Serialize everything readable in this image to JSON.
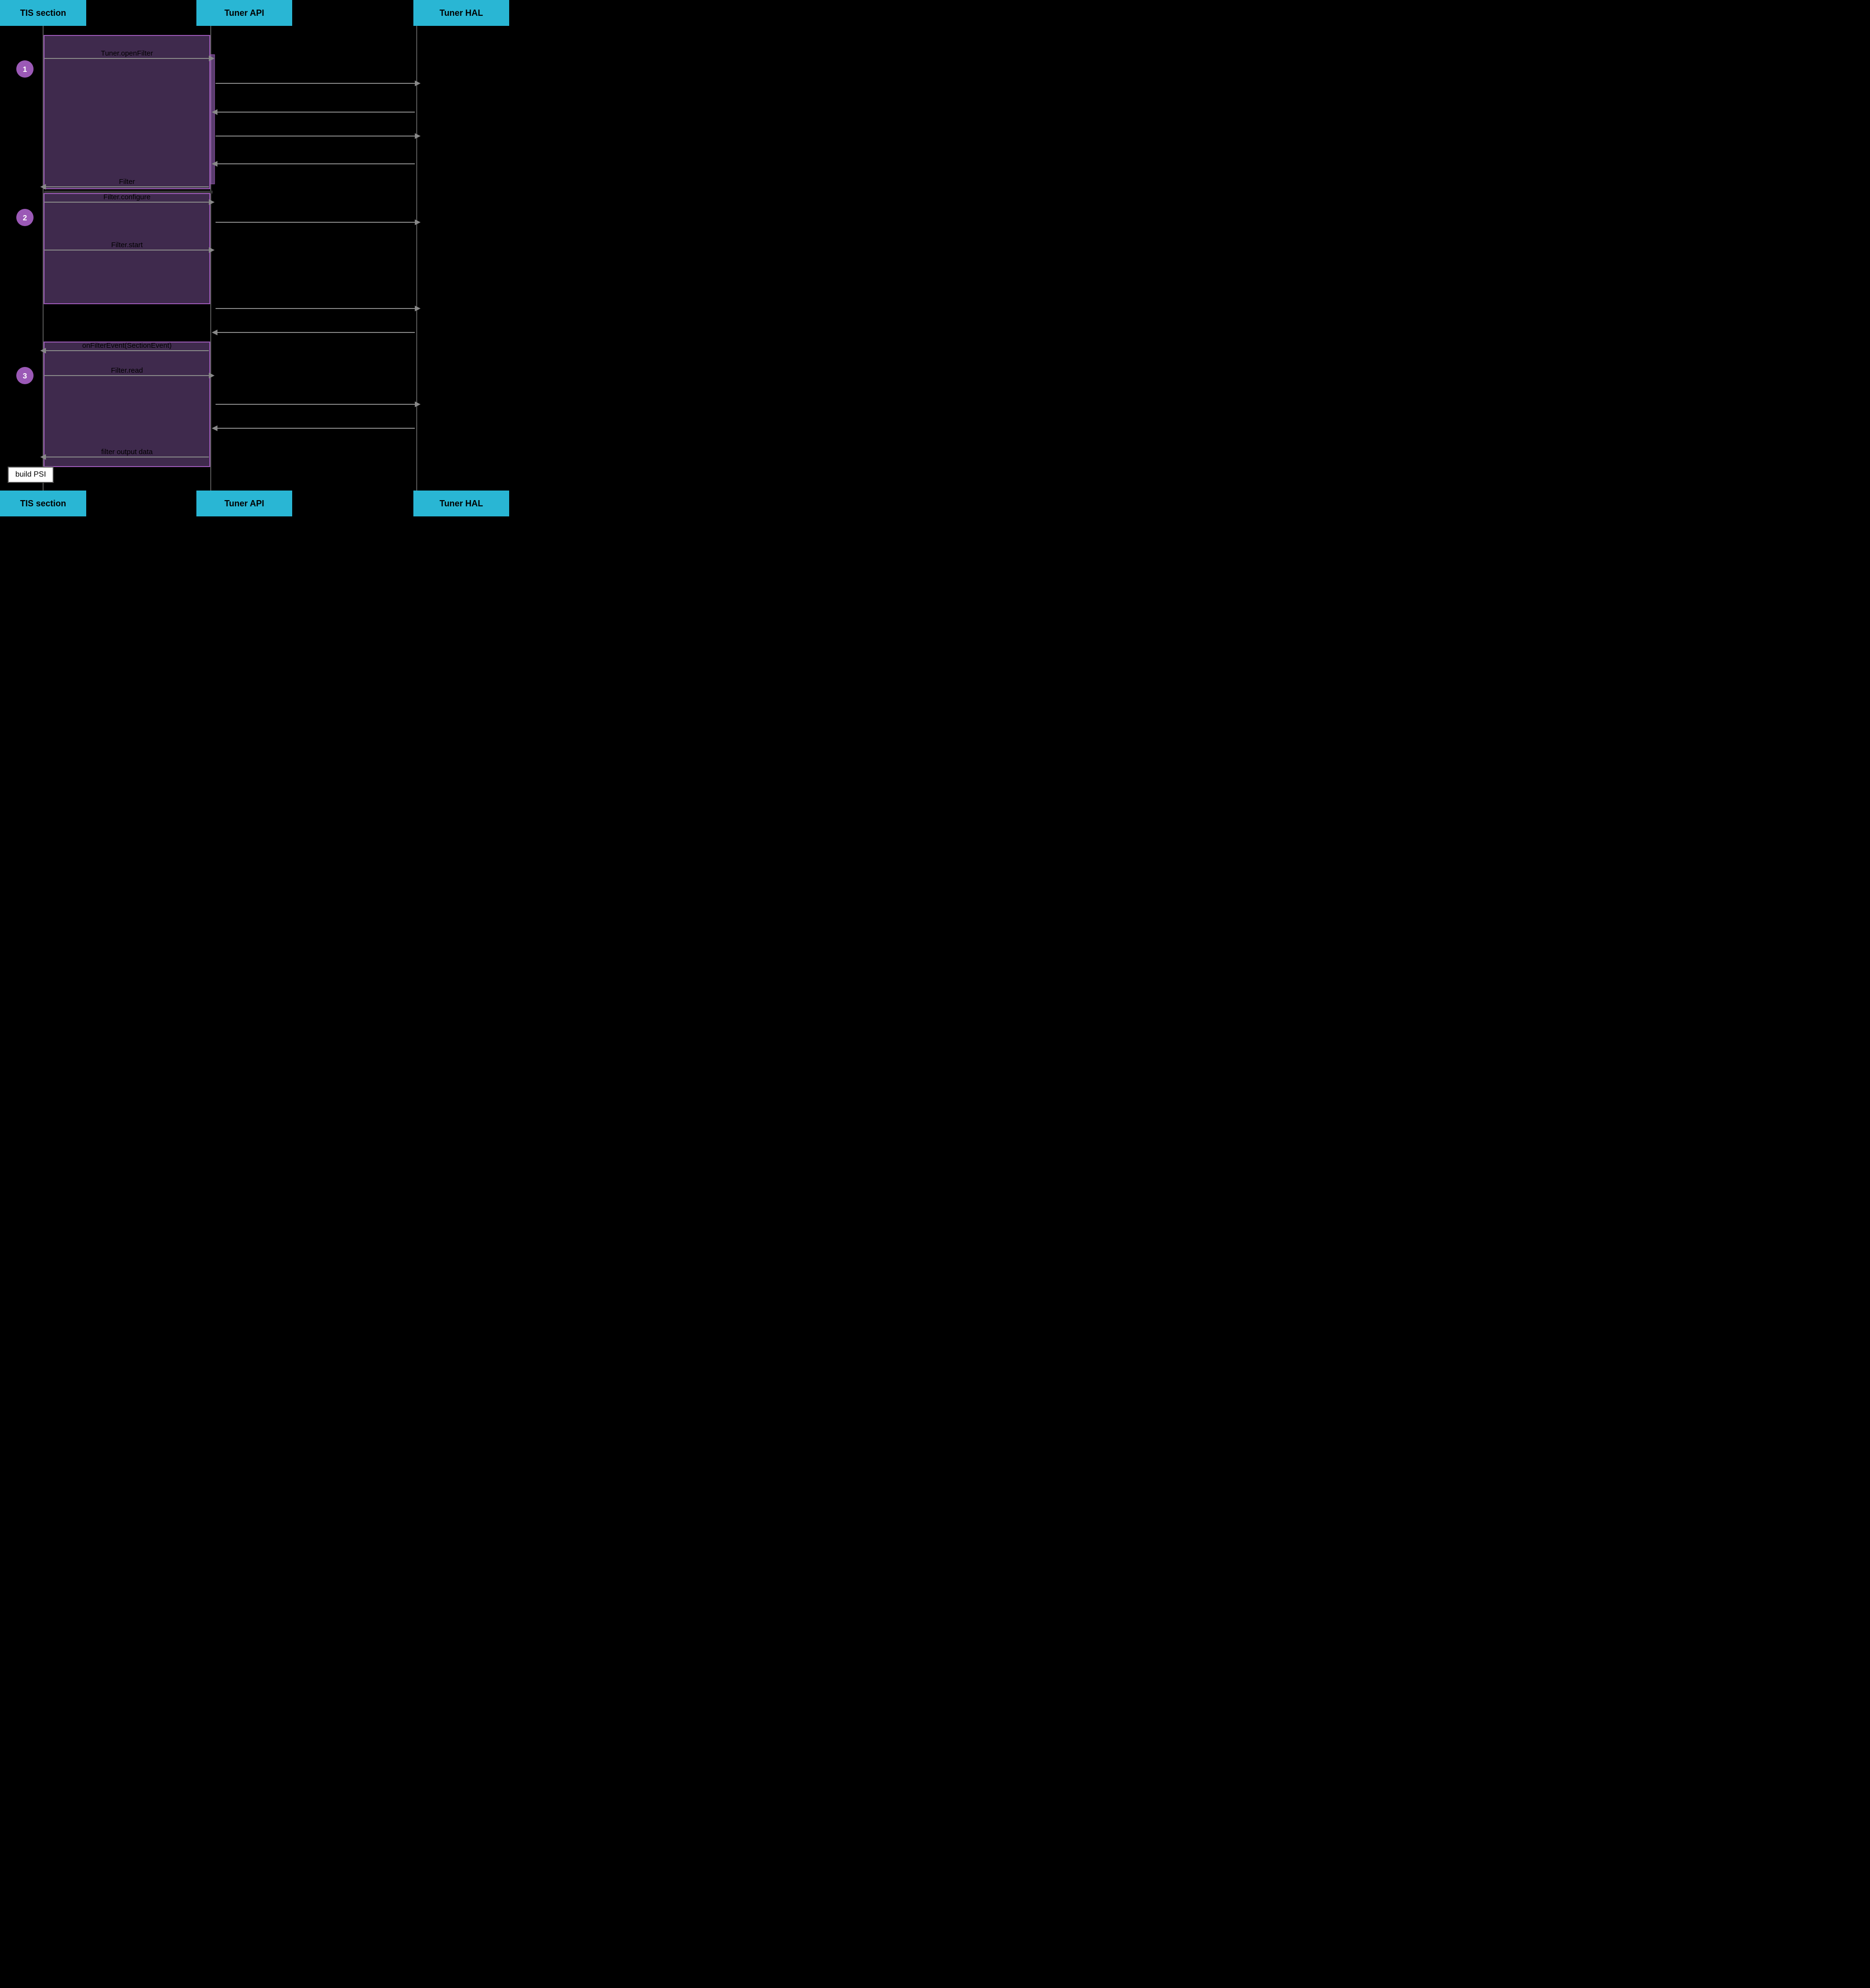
{
  "header": {
    "tis_label": "TIS section",
    "tuner_api_label": "Tuner API",
    "tuner_hal_label": "Tuner HAL"
  },
  "footer": {
    "tis_label": "TIS section",
    "tuner_api_label": "Tuner API",
    "tuner_hal_label": "Tuner HAL"
  },
  "steps": [
    {
      "number": "1"
    },
    {
      "number": "2"
    },
    {
      "number": "3"
    }
  ],
  "arrows": [
    {
      "id": "tuner-open-filter",
      "label": "Tuner.openFilter",
      "from": "tis",
      "to": "tunerapi",
      "dir": "right"
    },
    {
      "id": "hal-arrow-1",
      "label": "",
      "from": "tunerapi",
      "to": "tunerhal",
      "dir": "right"
    },
    {
      "id": "hal-return-1",
      "label": "",
      "from": "tunerhal",
      "to": "tunerapi",
      "dir": "left"
    },
    {
      "id": "hal-arrow-2",
      "label": "",
      "from": "tunerapi",
      "to": "tunerhal",
      "dir": "right"
    },
    {
      "id": "hal-return-2",
      "label": "",
      "from": "tunerhal",
      "to": "tunerapi",
      "dir": "left"
    },
    {
      "id": "filter-return",
      "label": "Filter",
      "from": "tunerapi",
      "to": "tis",
      "dir": "left"
    },
    {
      "id": "filter-configure",
      "label": "Filter.configure",
      "from": "tis",
      "to": "tunerapi",
      "dir": "right"
    },
    {
      "id": "hal-arrow-3",
      "label": "",
      "from": "tunerapi",
      "to": "tunerhal",
      "dir": "right"
    },
    {
      "id": "filter-start",
      "label": "Filter.start",
      "from": "tis",
      "to": "tunerapi",
      "dir": "right"
    },
    {
      "id": "hal-arrow-4",
      "label": "",
      "from": "tunerapi",
      "to": "tunerhal",
      "dir": "right"
    },
    {
      "id": "hal-return-3",
      "label": "",
      "from": "tunerhal",
      "to": "tunerapi",
      "dir": "left"
    },
    {
      "id": "on-filter-event",
      "label": "onFilterEvent(SectionEvent)",
      "from": "tunerapi",
      "to": "tis",
      "dir": "left"
    },
    {
      "id": "filter-read",
      "label": "Filter.read",
      "from": "tis",
      "to": "tunerapi",
      "dir": "right"
    },
    {
      "id": "hal-arrow-5",
      "label": "",
      "from": "tunerapi",
      "to": "tunerhal",
      "dir": "right"
    },
    {
      "id": "hal-return-4",
      "label": "",
      "from": "tunerhal",
      "to": "tunerapi",
      "dir": "left"
    },
    {
      "id": "filter-output",
      "label": "filter output data",
      "from": "tunerapi",
      "to": "tis",
      "dir": "left"
    }
  ],
  "build_psi": {
    "label": "build PSI"
  },
  "colors": {
    "header_bg": "#29b6d4",
    "section_bg": "rgba(180,120,220,0.35)",
    "section_border": "#9b59b6",
    "badge_bg": "#9b59b6",
    "arrow_color": "#888",
    "lifeline_color": "#555"
  }
}
